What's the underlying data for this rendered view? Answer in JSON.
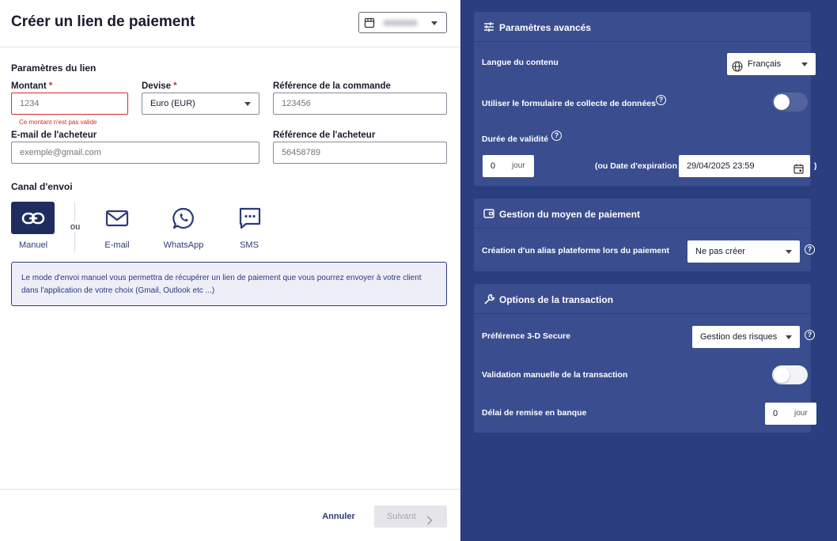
{
  "header": {
    "title": "Créer un lien de paiement",
    "shop_icon": "store-icon"
  },
  "link_params": {
    "section_title": "Paramètres du lien",
    "amount": {
      "label": "Montant",
      "required": "*",
      "placeholder": "1234",
      "error": "Ce montant n'est pas valide"
    },
    "currency": {
      "label": "Devise",
      "required": "*",
      "value": "Euro (EUR)"
    },
    "order_ref": {
      "label": "Référence de la commande",
      "placeholder": "123456"
    },
    "buyer_email": {
      "label": "E-mail de l'acheteur",
      "placeholder": "exemple@gmail.com"
    },
    "buyer_ref": {
      "label": "Référence de l'acheteur",
      "placeholder": "56458789"
    }
  },
  "send_channel": {
    "section_title": "Canal d'envoi",
    "or_label": "ou",
    "options": [
      {
        "label": "Manuel",
        "icon": "link-icon",
        "active": true
      },
      {
        "label": "E-mail",
        "icon": "mail-icon"
      },
      {
        "label": "WhatsApp",
        "icon": "whatsapp-icon"
      },
      {
        "label": "SMS",
        "icon": "sms-icon"
      }
    ],
    "info": "Le mode d'envoi manuel vous permettra de récupérer un lien de paiement que vous pourrez envoyer à votre client dans l'application de votre choix (Gmail, Outlook etc ...)"
  },
  "footer": {
    "cancel": "Annuler",
    "next": "Suivant"
  },
  "advanced": {
    "title": "Paramètres avancés",
    "language_label": "Langue du contenu",
    "language_value": "Français",
    "data_form_label": "Utiliser le formulaire de collecte de données",
    "data_form_enabled": false,
    "validity_label": "Durée de validité",
    "validity_value": "0",
    "validity_unit": "jour",
    "expiration_label": "(ou Date d'expiration",
    "expiration_value": "29/04/2025 23:59",
    "expiration_close": ")"
  },
  "payment_method": {
    "title": "Gestion du moyen de paiement",
    "alias_label": "Création d'un alias plateforme lors du paiement",
    "alias_value": "Ne pas créer"
  },
  "transaction": {
    "title": "Options de la transaction",
    "secure_label": "Préférence 3-D Secure",
    "secure_value": "Gestion des risques",
    "manual_validation_label": "Validation manuelle de la transaction",
    "manual_validation_enabled": false,
    "delay_label": "Délai de remise en banque",
    "delay_value": "0",
    "delay_unit": "jour"
  },
  "colors": {
    "primary": "#2b3e80",
    "card": "#3a4d8f",
    "error": "#d62b2b",
    "active_channel": "#1f2d5e"
  }
}
